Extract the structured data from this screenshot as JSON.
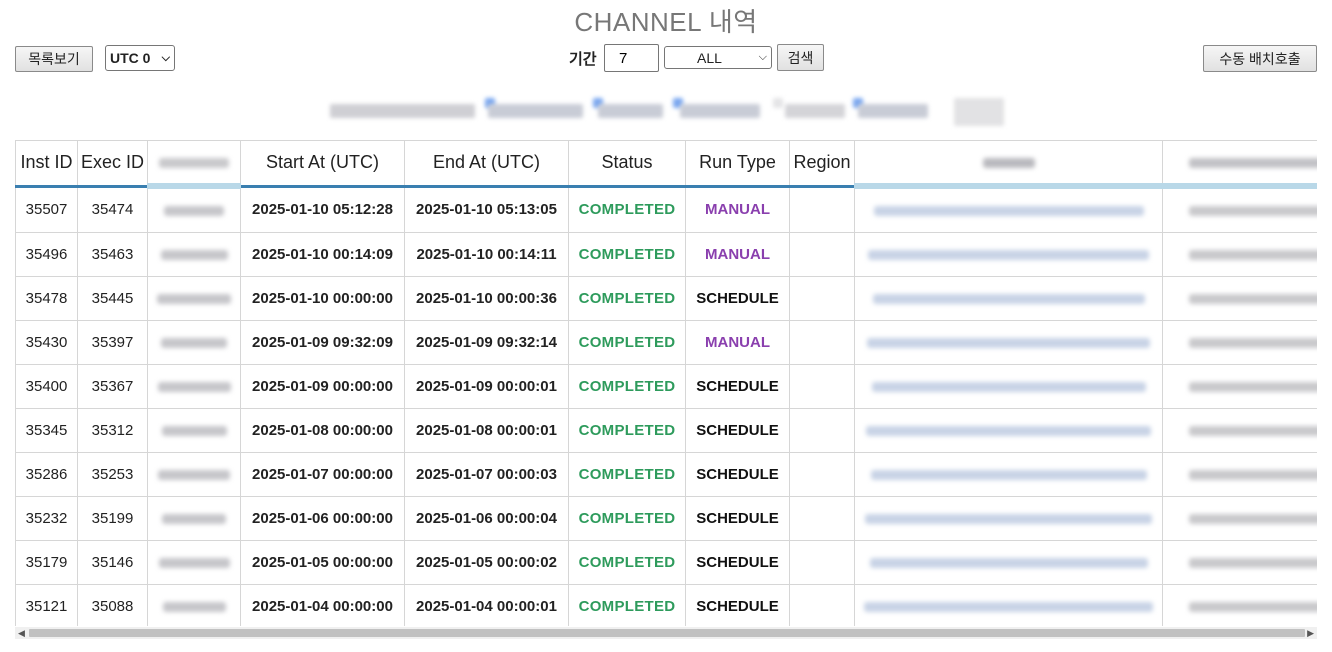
{
  "page_title": "CHANNEL 내역",
  "toolbar": {
    "list_button": "목록보기",
    "timezone_value": "UTC 0",
    "period_label": "기간",
    "period_value": "7",
    "filter_value": "ALL",
    "search_button": "검색",
    "manual_batch_button": "수동 배치호출"
  },
  "table": {
    "headers": [
      "Inst ID",
      "Exec ID",
      "",
      "Start At (UTC)",
      "End At (UTC)",
      "Status",
      "Run Type",
      "Region",
      "",
      ""
    ],
    "rows": [
      {
        "inst": "35507",
        "exec": "35474",
        "start": "2025-01-10 05:12:28",
        "end": "2025-01-10 05:13:05",
        "status": "COMPLETED",
        "run_type": "MANUAL",
        "region": ""
      },
      {
        "inst": "35496",
        "exec": "35463",
        "start": "2025-01-10 00:14:09",
        "end": "2025-01-10 00:14:11",
        "status": "COMPLETED",
        "run_type": "MANUAL",
        "region": ""
      },
      {
        "inst": "35478",
        "exec": "35445",
        "start": "2025-01-10 00:00:00",
        "end": "2025-01-10 00:00:36",
        "status": "COMPLETED",
        "run_type": "SCHEDULE",
        "region": ""
      },
      {
        "inst": "35430",
        "exec": "35397",
        "start": "2025-01-09 09:32:09",
        "end": "2025-01-09 09:32:14",
        "status": "COMPLETED",
        "run_type": "MANUAL",
        "region": ""
      },
      {
        "inst": "35400",
        "exec": "35367",
        "start": "2025-01-09 00:00:00",
        "end": "2025-01-09 00:00:01",
        "status": "COMPLETED",
        "run_type": "SCHEDULE",
        "region": ""
      },
      {
        "inst": "35345",
        "exec": "35312",
        "start": "2025-01-08 00:00:00",
        "end": "2025-01-08 00:00:01",
        "status": "COMPLETED",
        "run_type": "SCHEDULE",
        "region": ""
      },
      {
        "inst": "35286",
        "exec": "35253",
        "start": "2025-01-07 00:00:00",
        "end": "2025-01-07 00:00:03",
        "status": "COMPLETED",
        "run_type": "SCHEDULE",
        "region": ""
      },
      {
        "inst": "35232",
        "exec": "35199",
        "start": "2025-01-06 00:00:00",
        "end": "2025-01-06 00:00:04",
        "status": "COMPLETED",
        "run_type": "SCHEDULE",
        "region": ""
      },
      {
        "inst": "35179",
        "exec": "35146",
        "start": "2025-01-05 00:00:00",
        "end": "2025-01-05 00:00:02",
        "status": "COMPLETED",
        "run_type": "SCHEDULE",
        "region": ""
      },
      {
        "inst": "35121",
        "exec": "35088",
        "start": "2025-01-04 00:00:00",
        "end": "2025-01-04 00:00:01",
        "status": "COMPLETED",
        "run_type": "SCHEDULE",
        "region": ""
      }
    ]
  },
  "colors": {
    "completed": "#2e9b5c",
    "manual": "#8a3fae",
    "schedule": "#111111",
    "header_underline": "#3a7fb0"
  },
  "icons": {
    "select_arrow": "chevron-down-icon",
    "scroll_left": "scroll-left-arrow-icon",
    "scroll_right": "scroll-right-arrow-icon"
  }
}
